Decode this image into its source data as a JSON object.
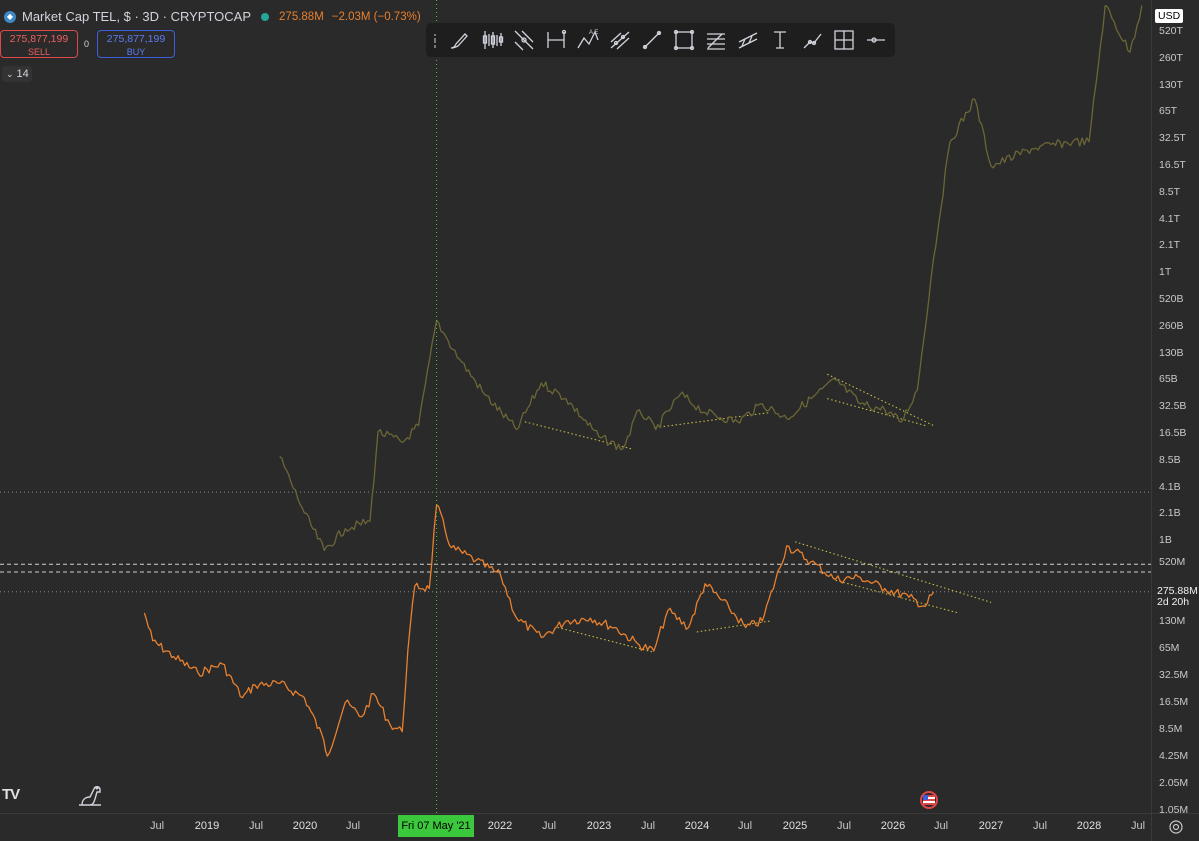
{
  "legend": {
    "symbol_icon": "telcoin-icon",
    "title": "Market Cap TEL, $ · 3D · CRYPTOCAP",
    "value": "275.88M",
    "change": "−2.03M (−0.73%)",
    "status_color": "#26a69a"
  },
  "trade": {
    "sell_price": "275,877,199",
    "sell_label": "SELL",
    "spread": "0",
    "buy_price": "275,877,199",
    "buy_label": "BUY"
  },
  "collapse": {
    "icon": "chevron-down-icon",
    "count": "14"
  },
  "toolbar": {
    "tools": [
      "brush-icon",
      "candles-icon",
      "cross-lines-icon",
      "date-range-icon",
      "abcd-pattern-icon",
      "pitchfork-icon",
      "trend-line-icon",
      "rectangle-icon",
      "fib-retracement-icon",
      "parallel-channel-icon",
      "text-cursor-icon",
      "ray-icon",
      "crosshair-frame-icon",
      "horizontal-ray-icon"
    ]
  },
  "price_scale": {
    "currency": "USD",
    "labels": [
      "520T",
      "260T",
      "130T",
      "65T",
      "32.5T",
      "16.5T",
      "8.5T",
      "4.1T",
      "2.1T",
      "1T",
      "520B",
      "260B",
      "130B",
      "65B",
      "32.5B",
      "16.5B",
      "8.5B",
      "4.1B",
      "2.1B",
      "1B",
      "520M",
      "130M",
      "65M",
      "32.5M",
      "16.5M",
      "8.5M",
      "4.25M",
      "2.05M",
      "1.05M"
    ],
    "last_price": "275.88M",
    "countdown": "2d 20h"
  },
  "time_scale": {
    "labels": [
      "Jul",
      "2019",
      "Jul",
      "2020",
      "Jul",
      "2022",
      "Jul",
      "2023",
      "Jul",
      "2024",
      "Jul",
      "2025",
      "Jul",
      "2026",
      "Jul",
      "2027",
      "Jul",
      "2028",
      "Jul"
    ],
    "crosshair_date": "Fri 07 May '21"
  },
  "branding": {
    "logo": "tradingview-logo",
    "logo_text": "TV"
  },
  "colors": {
    "market_cap_line": "#e8802e",
    "overlay_line": "#6b6636",
    "trend_dotted": "#d4c84a",
    "crosshair": "#3cc83c",
    "background": "#2a2a2a"
  },
  "chart_data": {
    "type": "line",
    "title": "Market Cap TEL, $ · 3D · CRYPTOCAP",
    "xlabel": "",
    "ylabel": "",
    "y_scale": "log",
    "ylim": [
      1050000,
      520000000000000
    ],
    "xlim": [
      "2018-04-01",
      "2028-10-01"
    ],
    "grid": false,
    "series": [
      {
        "name": "Market Cap TEL",
        "color": "#e8802e",
        "points": [
          [
            "2018-05-15",
            160000000
          ],
          [
            "2018-06-15",
            78000000
          ],
          [
            "2018-09-01",
            52000000
          ],
          [
            "2018-12-01",
            34000000
          ],
          [
            "2019-03-01",
            43000000
          ],
          [
            "2019-05-15",
            18000000
          ],
          [
            "2019-07-01",
            25000000
          ],
          [
            "2019-10-01",
            26000000
          ],
          [
            "2020-01-01",
            18000000
          ],
          [
            "2020-03-13",
            6000000
          ],
          [
            "2020-03-26",
            4000000
          ],
          [
            "2020-06-01",
            16000000
          ],
          [
            "2020-08-01",
            11000000
          ],
          [
            "2020-09-15",
            20000000
          ],
          [
            "2020-11-15",
            9000000
          ],
          [
            "2020-12-30",
            7500000
          ],
          [
            "2021-01-20",
            60000000
          ],
          [
            "2021-02-15",
            320000000
          ],
          [
            "2021-04-10",
            300000000
          ],
          [
            "2021-05-07",
            2600000000
          ],
          [
            "2021-07-01",
            860000000
          ],
          [
            "2021-10-01",
            620000000
          ],
          [
            "2022-01-01",
            420000000
          ],
          [
            "2022-03-01",
            140000000
          ],
          [
            "2022-06-01",
            85000000
          ],
          [
            "2022-09-01",
            130000000
          ],
          [
            "2022-12-01",
            140000000
          ],
          [
            "2023-03-01",
            110000000
          ],
          [
            "2023-06-01",
            70000000
          ],
          [
            "2023-07-25",
            60000000
          ],
          [
            "2023-09-15",
            170000000
          ],
          [
            "2023-12-01",
            110000000
          ],
          [
            "2024-02-01",
            340000000
          ],
          [
            "2024-05-01",
            180000000
          ],
          [
            "2024-07-01",
            110000000
          ],
          [
            "2024-09-01",
            130000000
          ],
          [
            "2024-12-01",
            900000000
          ],
          [
            "2025-03-01",
            600000000
          ],
          [
            "2025-06-01",
            380000000
          ],
          [
            "2025-09-01",
            400000000
          ],
          [
            "2025-12-01",
            300000000
          ],
          [
            "2026-03-01",
            240000000
          ],
          [
            "2026-05-01",
            190000000
          ],
          [
            "2026-06-01",
            275880000
          ]
        ]
      },
      {
        "name": "",
        "color": "#6b6636",
        "points": [
          [
            "2019-10-01",
            9000000000
          ],
          [
            "2020-01-01",
            2100000000
          ],
          [
            "2020-03-15",
            800000000
          ],
          [
            "2020-06-01",
            1400000000
          ],
          [
            "2020-09-01",
            1700000000
          ],
          [
            "2020-10-01",
            17000000000
          ],
          [
            "2021-01-01",
            13000000000
          ],
          [
            "2021-03-01",
            20000000000
          ],
          [
            "2021-05-07",
            300000000000
          ],
          [
            "2021-06-01",
            220000000000
          ],
          [
            "2021-08-01",
            110000000000
          ],
          [
            "2021-11-01",
            45000000000
          ],
          [
            "2022-03-01",
            18000000000
          ],
          [
            "2022-06-01",
            60000000000
          ],
          [
            "2022-09-01",
            40000000000
          ],
          [
            "2023-01-01",
            15000000000
          ],
          [
            "2023-04-01",
            11000000000
          ],
          [
            "2023-06-01",
            30000000000
          ],
          [
            "2023-08-01",
            18000000000
          ],
          [
            "2023-11-01",
            45000000000
          ],
          [
            "2024-02-01",
            28000000000
          ],
          [
            "2024-06-01",
            22000000000
          ],
          [
            "2024-09-01",
            35000000000
          ],
          [
            "2024-12-01",
            24000000000
          ],
          [
            "2025-03-01",
            40000000000
          ],
          [
            "2025-06-01",
            65000000000
          ],
          [
            "2025-09-01",
            35000000000
          ],
          [
            "2025-12-01",
            30000000000
          ],
          [
            "2026-02-01",
            22000000000
          ],
          [
            "2026-04-01",
            50000000000
          ],
          [
            "2026-06-01",
            1500000000000
          ],
          [
            "2026-08-01",
            30000000000000
          ],
          [
            "2026-11-01",
            90000000000000
          ],
          [
            "2027-01-01",
            16000000000000
          ],
          [
            "2027-06-01",
            25000000000000
          ],
          [
            "2027-11-01",
            30000000000000
          ],
          [
            "2028-01-01",
            30000000000000
          ],
          [
            "2028-03-01",
            1000000000000000
          ],
          [
            "2028-06-01",
            300000000000000
          ],
          [
            "2028-07-15",
            1000000000000000
          ]
        ]
      }
    ],
    "trendlines": [
      {
        "color": "#d4c84a",
        "style": "dotted",
        "from": [
          "2022-04-01",
          22000000000
        ],
        "to": [
          "2023-05-01",
          11000000000
        ]
      },
      {
        "color": "#d4c84a",
        "style": "dotted",
        "from": [
          "2023-08-01",
          19000000000
        ],
        "to": [
          "2024-10-01",
          28000000000
        ]
      },
      {
        "color": "#d4c84a",
        "style": "dotted",
        "from": [
          "2025-05-01",
          75000000000
        ],
        "to": [
          "2026-06-01",
          20000000000
        ]
      },
      {
        "color": "#d4c84a",
        "style": "dotted",
        "from": [
          "2025-05-01",
          40000000000
        ],
        "to": [
          "2026-05-01",
          20000000000
        ]
      },
      {
        "color": "#d4c84a",
        "style": "dotted",
        "from": [
          "2022-08-01",
          110000000
        ],
        "to": [
          "2023-07-25",
          58000000
        ]
      },
      {
        "color": "#d4c84a",
        "style": "dotted",
        "from": [
          "2024-01-01",
          98000000
        ],
        "to": [
          "2024-10-01",
          130000000
        ]
      },
      {
        "color": "#d4c84a",
        "style": "dotted",
        "from": [
          "2025-01-01",
          1000000000
        ],
        "to": [
          "2027-01-01",
          210000000
        ]
      },
      {
        "color": "#d4c84a",
        "style": "dotted",
        "from": [
          "2025-06-01",
          370000000
        ],
        "to": [
          "2026-09-01",
          160000000
        ]
      }
    ],
    "horizontal_lines": [
      {
        "style": "dashed",
        "value": 560000000
      },
      {
        "style": "dashed",
        "value": 460000000
      },
      {
        "style": "dotted",
        "value": 3600000000
      },
      {
        "style": "dotted",
        "value": 275880000
      }
    ],
    "crosshair_x": "2021-05-07"
  }
}
